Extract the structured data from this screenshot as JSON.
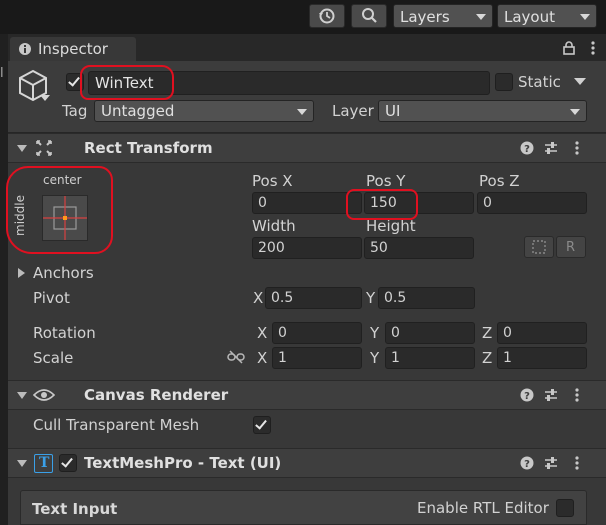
{
  "toolbar": {
    "history_icon": "history-icon",
    "search_icon": "search-icon",
    "layers_label": "Layers",
    "layout_label": "Layout"
  },
  "tab": {
    "label": "Inspector",
    "icon": "inspector-icon",
    "lock_icon": "lock-icon",
    "menu_icon": "kebab-menu-icon"
  },
  "gameobject": {
    "active": true,
    "name": "WinText",
    "static_label": "Static",
    "static_checked": false,
    "tag_label": "Tag",
    "tag_value": "Untagged",
    "layer_label": "Layer",
    "layer_value": "UI"
  },
  "rect_transform": {
    "title": "Rect Transform",
    "anchor_preset_top": "center",
    "anchor_preset_side": "middle",
    "pos_x_label": "Pos X",
    "pos_y_label": "Pos Y",
    "pos_z_label": "Pos Z",
    "pos_x": "0",
    "pos_y": "150",
    "pos_z": "0",
    "width_label": "Width",
    "height_label": "Height",
    "width": "200",
    "height": "50",
    "blueprint_mode_label": "",
    "raw_edit_label": "R",
    "anchors_label": "Anchors",
    "pivot_label": "Pivot",
    "pivot_x_label": "X",
    "pivot_y_label": "Y",
    "pivot_x": "0.5",
    "pivot_y": "0.5",
    "rotation_label": "Rotation",
    "rotation": {
      "x_label": "X",
      "y_label": "Y",
      "z_label": "Z",
      "x": "0",
      "y": "0",
      "z": "0"
    },
    "scale_label": "Scale",
    "scale": {
      "x_label": "X",
      "y_label": "Y",
      "z_label": "Z",
      "x": "1",
      "y": "1",
      "z": "1"
    }
  },
  "canvas_renderer": {
    "title": "Canvas Renderer",
    "cull_label": "Cull Transparent Mesh",
    "cull_checked": true
  },
  "textmeshpro": {
    "title": "TextMeshPro - Text (UI)",
    "enabled": true,
    "icon_letter": "T",
    "text_input_label": "Text Input",
    "rtl_label": "Enable RTL Editor",
    "rtl_checked": false
  },
  "colors": {
    "background": "#191919",
    "panel": "#383838",
    "header": "#3e3e3e",
    "field": "#2a2a2a",
    "annotation_red": "#e01020",
    "anchor_red": "#d84040",
    "pivot_orange": "#ff9a1a"
  }
}
